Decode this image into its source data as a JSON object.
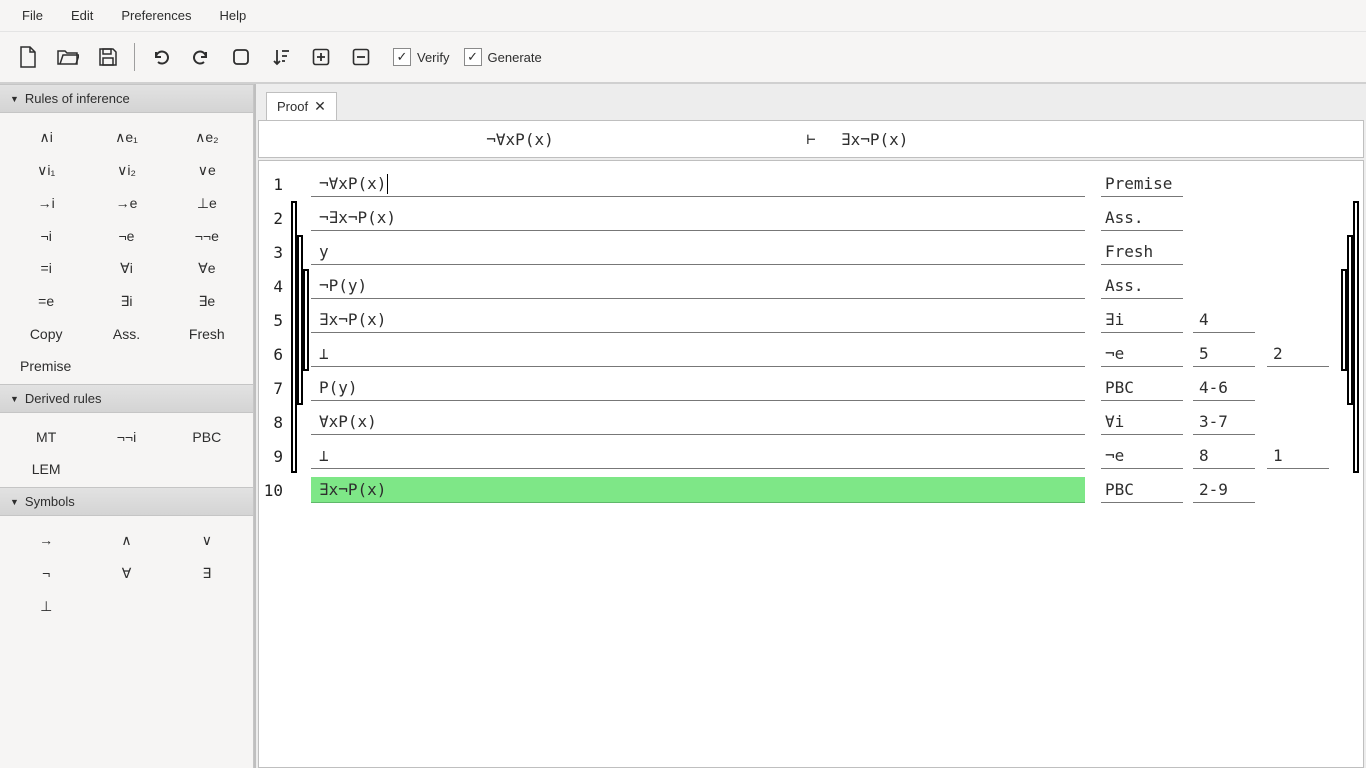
{
  "menu": {
    "file": "File",
    "edit": "Edit",
    "preferences": "Preferences",
    "help": "Help"
  },
  "toolbar": {
    "verify": "Verify",
    "generate": "Generate",
    "verify_checked": true,
    "generate_checked": true
  },
  "panels": {
    "rules": {
      "title": "Rules of inference",
      "items": [
        "∧i",
        "∧e₁",
        "∧e₂",
        "∨i₁",
        "∨i₂",
        "∨e",
        "→i",
        "→e",
        "⊥e",
        "¬i",
        "¬e",
        "¬¬e",
        "=i",
        "∀i",
        "∀e",
        "=e",
        "∃i",
        "∃e",
        "Copy",
        "Ass.",
        "Fresh",
        "Premise"
      ]
    },
    "derived": {
      "title": "Derived rules",
      "items": [
        "MT",
        "¬¬i",
        "PBC",
        "LEM"
      ]
    },
    "symbols": {
      "title": "Symbols",
      "items": [
        "→",
        "∧",
        "∨",
        "¬",
        "∀",
        "∃",
        "⊥"
      ]
    }
  },
  "tab": {
    "label": "Proof"
  },
  "sequent": {
    "left": "¬∀xP(x)",
    "turnstile": "⊢",
    "right": "∃x¬P(x)"
  },
  "proof": {
    "rows": [
      {
        "n": 1,
        "depth": 0,
        "top": [],
        "bot": [],
        "formula": "¬∀xP(x)",
        "cursor": true,
        "just": "Premise",
        "refs": []
      },
      {
        "n": 2,
        "depth": 1,
        "top": [
          1
        ],
        "bot": [],
        "formula": "¬∃x¬P(x)",
        "just": "Ass.",
        "refs": []
      },
      {
        "n": 3,
        "depth": 2,
        "top": [
          2
        ],
        "bot": [],
        "formula": "y",
        "just": "Fresh",
        "refs": []
      },
      {
        "n": 4,
        "depth": 3,
        "top": [
          3
        ],
        "bot": [],
        "formula": "¬P(y)",
        "just": "Ass.",
        "refs": []
      },
      {
        "n": 5,
        "depth": 3,
        "top": [],
        "bot": [],
        "formula": "∃x¬P(x)",
        "just": "∃i",
        "refs": [
          "4"
        ]
      },
      {
        "n": 6,
        "depth": 3,
        "top": [],
        "bot": [
          3
        ],
        "formula": "⊥",
        "just": "¬e",
        "refs": [
          "5",
          "2"
        ]
      },
      {
        "n": 7,
        "depth": 2,
        "top": [],
        "bot": [
          2
        ],
        "formula": "P(y)",
        "just": "PBC",
        "refs": [
          "4-6"
        ]
      },
      {
        "n": 8,
        "depth": 1,
        "top": [],
        "bot": [],
        "formula": "∀xP(x)",
        "just": "∀i",
        "refs": [
          "3-7"
        ]
      },
      {
        "n": 9,
        "depth": 1,
        "top": [],
        "bot": [
          1
        ],
        "formula": "⊥",
        "just": "¬e",
        "refs": [
          "8",
          "1"
        ]
      },
      {
        "n": 10,
        "depth": 0,
        "top": [],
        "bot": [],
        "formula": "∃x¬P(x)",
        "hl": true,
        "just": "PBC",
        "refs": [
          "2-9"
        ]
      }
    ]
  }
}
